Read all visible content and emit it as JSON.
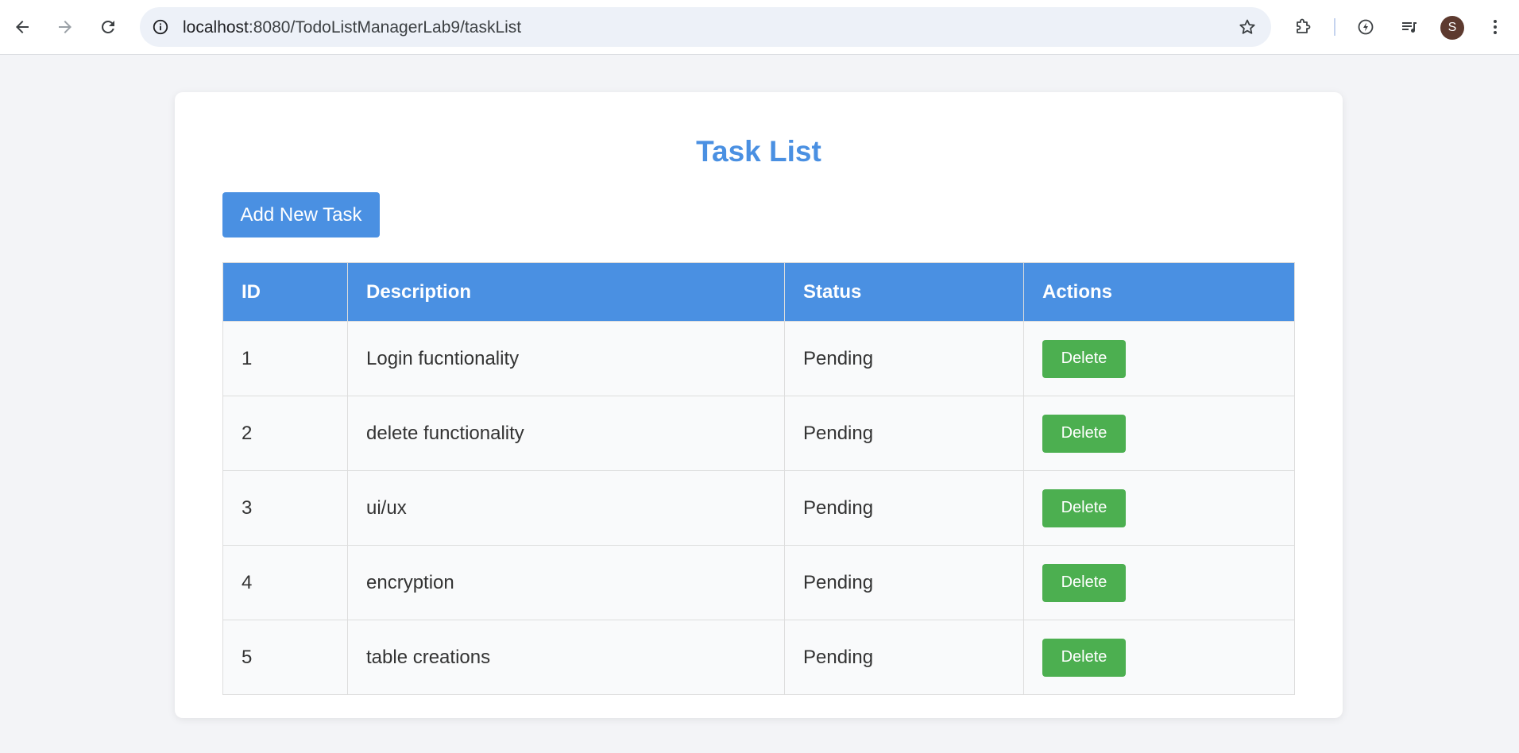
{
  "browser": {
    "url_host": "localhost",
    "url_path": ":8080/TodoListManagerLab9/taskList",
    "profile_initial": "S"
  },
  "page": {
    "title": "Task List",
    "add_button_label": "Add New Task",
    "columns": [
      "ID",
      "Description",
      "Status",
      "Actions"
    ],
    "tasks": [
      {
        "id": "1",
        "description": "Login fucntionality",
        "status": "Pending",
        "action": "Delete"
      },
      {
        "id": "2",
        "description": "delete functionality",
        "status": "Pending",
        "action": "Delete"
      },
      {
        "id": "3",
        "description": "ui/ux",
        "status": "Pending",
        "action": "Delete"
      },
      {
        "id": "4",
        "description": "encryption",
        "status": "Pending",
        "action": "Delete"
      },
      {
        "id": "5",
        "description": "table creations",
        "status": "Pending",
        "action": "Delete"
      }
    ]
  },
  "colors": {
    "accent": "#4a90e2",
    "delete": "#4caf50",
    "page_bg": "#f3f4f7"
  },
  "icons": {
    "back": "arrow-left-icon",
    "forward": "arrow-right-icon",
    "reload": "reload-icon",
    "site_info": "info-icon",
    "bookmark": "star-icon",
    "extensions": "puzzle-icon",
    "performance": "lightning-icon",
    "media": "media-queue-icon",
    "menu": "kebab-menu-icon"
  }
}
